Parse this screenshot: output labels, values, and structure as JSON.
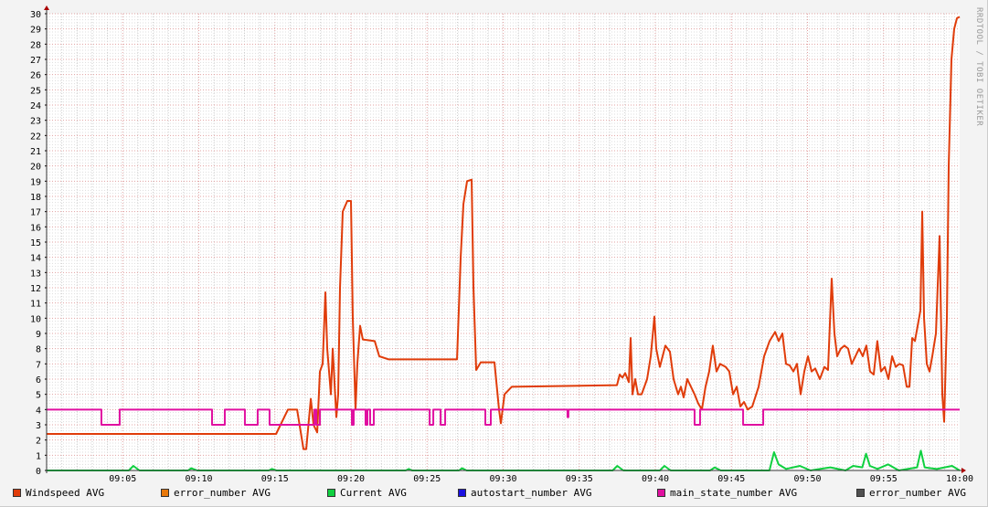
{
  "chart_data": {
    "type": "line",
    "title": "",
    "xlabel": "",
    "ylabel": "",
    "xlim_minutes": [
      0,
      60
    ],
    "ylim": [
      0,
      30
    ],
    "grid": true,
    "legend_placement": "bottom",
    "x_ticks": [
      {
        "m": 5,
        "label": "09:05"
      },
      {
        "m": 10,
        "label": "09:10"
      },
      {
        "m": 15,
        "label": "09:15"
      },
      {
        "m": 20,
        "label": "09:20"
      },
      {
        "m": 25,
        "label": "09:25"
      },
      {
        "m": 30,
        "label": "09:30"
      },
      {
        "m": 35,
        "label": "09:35"
      },
      {
        "m": 40,
        "label": "09:40"
      },
      {
        "m": 45,
        "label": "09:45"
      },
      {
        "m": 50,
        "label": "09:50"
      },
      {
        "m": 55,
        "label": "09:55"
      },
      {
        "m": 60,
        "label": "10:00"
      }
    ],
    "y_ticks": [
      0,
      1,
      2,
      3,
      4,
      5,
      6,
      7,
      8,
      9,
      10,
      11,
      12,
      13,
      14,
      15,
      16,
      17,
      18,
      19,
      20,
      21,
      22,
      23,
      24,
      25,
      26,
      27,
      28,
      29,
      30
    ],
    "watermark": "RRDTOOL / TOBI OETIKER",
    "series": [
      {
        "name": "Windspeed AVG",
        "color": "#e03c0a",
        "step": false,
        "points": [
          [
            0,
            2.4
          ],
          [
            15.08,
            2.4
          ],
          [
            15.86,
            4
          ],
          [
            16.46,
            4
          ],
          [
            16.88,
            1.4
          ],
          [
            17.06,
            1.4
          ],
          [
            17.36,
            4.7
          ],
          [
            17.54,
            3
          ],
          [
            17.78,
            2.5
          ],
          [
            17.96,
            6.5
          ],
          [
            18.14,
            7
          ],
          [
            18.32,
            11.7
          ],
          [
            18.44,
            8
          ],
          [
            18.68,
            5
          ],
          [
            18.8,
            8
          ],
          [
            19.04,
            3.5
          ],
          [
            19.16,
            5
          ],
          [
            19.28,
            12
          ],
          [
            19.46,
            17
          ],
          [
            19.76,
            17.7
          ],
          [
            20.0,
            17.7
          ],
          [
            20.12,
            10
          ],
          [
            20.3,
            4
          ],
          [
            20.42,
            7
          ],
          [
            20.6,
            9.5
          ],
          [
            20.78,
            8.6
          ],
          [
            21.56,
            8.5
          ],
          [
            21.86,
            7.5
          ],
          [
            22.46,
            7.3
          ],
          [
            26.97,
            7.3
          ],
          [
            27.21,
            14
          ],
          [
            27.39,
            17.5
          ],
          [
            27.63,
            19
          ],
          [
            27.93,
            19.1
          ],
          [
            28.05,
            12
          ],
          [
            28.23,
            6.6
          ],
          [
            28.53,
            7.1
          ],
          [
            29.43,
            7.1
          ],
          [
            29.73,
            4
          ],
          [
            29.85,
            3.1
          ],
          [
            30.09,
            5
          ],
          [
            30.57,
            5.5
          ],
          [
            37.48,
            5.6
          ],
          [
            37.66,
            6.3
          ],
          [
            37.84,
            6.1
          ],
          [
            38.02,
            6.4
          ],
          [
            38.26,
            5.8
          ],
          [
            38.38,
            8.7
          ],
          [
            38.5,
            5
          ],
          [
            38.68,
            6
          ],
          [
            38.86,
            5
          ],
          [
            39.1,
            5
          ],
          [
            39.46,
            6
          ],
          [
            39.7,
            7.5
          ],
          [
            39.94,
            10.1
          ],
          [
            40.06,
            8
          ],
          [
            40.3,
            6.8
          ],
          [
            40.66,
            8.2
          ],
          [
            40.96,
            7.8
          ],
          [
            41.2,
            6
          ],
          [
            41.5,
            5
          ],
          [
            41.68,
            5.5
          ],
          [
            41.86,
            4.8
          ],
          [
            42.1,
            6
          ],
          [
            42.34,
            5.5
          ],
          [
            42.58,
            5
          ],
          [
            42.82,
            4.4
          ],
          [
            43.06,
            4
          ],
          [
            43.3,
            5.5
          ],
          [
            43.54,
            6.5
          ],
          [
            43.78,
            8.2
          ],
          [
            44.02,
            6.5
          ],
          [
            44.26,
            7
          ],
          [
            44.62,
            6.8
          ],
          [
            44.86,
            6.5
          ],
          [
            45.11,
            5
          ],
          [
            45.35,
            5.5
          ],
          [
            45.59,
            4.2
          ],
          [
            45.83,
            4.5
          ],
          [
            46.07,
            4
          ],
          [
            46.37,
            4.2
          ],
          [
            46.79,
            5.5
          ],
          [
            47.15,
            7.5
          ],
          [
            47.51,
            8.5
          ],
          [
            47.87,
            9.1
          ],
          [
            48.11,
            8.5
          ],
          [
            48.35,
            9
          ],
          [
            48.59,
            7
          ],
          [
            48.83,
            6.9
          ],
          [
            49.07,
            6.5
          ],
          [
            49.31,
            7
          ],
          [
            49.55,
            5
          ],
          [
            49.79,
            6.5
          ],
          [
            50.03,
            7.5
          ],
          [
            50.27,
            6.5
          ],
          [
            50.51,
            6.7
          ],
          [
            50.81,
            6
          ],
          [
            51.11,
            6.8
          ],
          [
            51.35,
            6.6
          ],
          [
            51.59,
            12.6
          ],
          [
            51.77,
            9
          ],
          [
            51.95,
            7.5
          ],
          [
            52.19,
            8
          ],
          [
            52.43,
            8.2
          ],
          [
            52.67,
            8
          ],
          [
            52.91,
            7
          ],
          [
            53.15,
            7.5
          ],
          [
            53.39,
            8
          ],
          [
            53.63,
            7.5
          ],
          [
            53.87,
            8.2
          ],
          [
            54.11,
            6.5
          ],
          [
            54.35,
            6.3
          ],
          [
            54.59,
            8.5
          ],
          [
            54.83,
            6.5
          ],
          [
            55.08,
            6.8
          ],
          [
            55.32,
            6
          ],
          [
            55.56,
            7.5
          ],
          [
            55.8,
            6.8
          ],
          [
            56.04,
            7
          ],
          [
            56.28,
            6.9
          ],
          [
            56.52,
            5.5
          ],
          [
            56.7,
            5.5
          ],
          [
            56.88,
            8.7
          ],
          [
            57.06,
            8.5
          ],
          [
            57.24,
            9.5
          ],
          [
            57.42,
            10.5
          ],
          [
            57.54,
            17
          ],
          [
            57.66,
            10
          ],
          [
            57.84,
            7
          ],
          [
            58.02,
            6.5
          ],
          [
            58.2,
            7.5
          ],
          [
            58.44,
            9
          ],
          [
            58.68,
            15.4
          ],
          [
            58.86,
            5
          ],
          [
            58.98,
            3.2
          ],
          [
            59.16,
            10
          ],
          [
            59.28,
            20
          ],
          [
            59.46,
            27
          ],
          [
            59.64,
            29
          ],
          [
            59.82,
            29.7
          ],
          [
            60,
            29.8
          ]
        ]
      },
      {
        "name": "error_number AVG",
        "color": "#e8780a",
        "step": false,
        "points": []
      },
      {
        "name": "Current AVG",
        "color": "#10d040",
        "step": false,
        "points": [
          [
            0,
            0
          ],
          [
            5.4,
            0
          ],
          [
            5.7,
            0.3
          ],
          [
            6.1,
            0
          ],
          [
            9.3,
            0
          ],
          [
            9.5,
            0.15
          ],
          [
            9.9,
            0
          ],
          [
            14.6,
            0
          ],
          [
            14.8,
            0.1
          ],
          [
            15.1,
            0
          ],
          [
            23.6,
            0
          ],
          [
            23.8,
            0.1
          ],
          [
            24.0,
            0
          ],
          [
            27.1,
            0
          ],
          [
            27.3,
            0.15
          ],
          [
            27.6,
            0
          ],
          [
            37.2,
            0
          ],
          [
            37.5,
            0.3
          ],
          [
            37.9,
            0
          ],
          [
            40.3,
            0
          ],
          [
            40.6,
            0.3
          ],
          [
            41.0,
            0
          ],
          [
            43.6,
            0
          ],
          [
            43.9,
            0.2
          ],
          [
            44.3,
            0
          ],
          [
            47.5,
            0
          ],
          [
            47.8,
            1.2
          ],
          [
            48.1,
            0.4
          ],
          [
            48.6,
            0.1
          ],
          [
            49.5,
            0.3
          ],
          [
            50.2,
            0
          ],
          [
            51.5,
            0.2
          ],
          [
            52.5,
            0
          ],
          [
            53.0,
            0.3
          ],
          [
            53.6,
            0.2
          ],
          [
            53.85,
            1.1
          ],
          [
            54.1,
            0.3
          ],
          [
            54.6,
            0.1
          ],
          [
            55.3,
            0.4
          ],
          [
            56.0,
            0
          ],
          [
            57.2,
            0.2
          ],
          [
            57.45,
            1.3
          ],
          [
            57.7,
            0.2
          ],
          [
            58.5,
            0.1
          ],
          [
            59.5,
            0.3
          ],
          [
            60,
            0
          ]
        ]
      },
      {
        "name": "autostart_number AVG",
        "color": "#1a10e0",
        "step": false,
        "points": []
      },
      {
        "name": "main_state_number AVG",
        "color": "#e010a0",
        "step": true,
        "points": [
          [
            0,
            4
          ],
          [
            3.6,
            3
          ],
          [
            4.8,
            4
          ],
          [
            10.87,
            3
          ],
          [
            11.71,
            4
          ],
          [
            13.03,
            3
          ],
          [
            13.87,
            4
          ],
          [
            14.65,
            3
          ],
          [
            17.6,
            4
          ],
          [
            17.72,
            3
          ],
          [
            17.96,
            4
          ],
          [
            20.06,
            3
          ],
          [
            20.18,
            4
          ],
          [
            20.96,
            3
          ],
          [
            21.08,
            4
          ],
          [
            21.26,
            3
          ],
          [
            21.5,
            4
          ],
          [
            25.17,
            3
          ],
          [
            25.41,
            4
          ],
          [
            25.89,
            3
          ],
          [
            26.19,
            4
          ],
          [
            28.83,
            3
          ],
          [
            29.19,
            4
          ],
          [
            34.23,
            3.5
          ],
          [
            34.29,
            4
          ],
          [
            42.58,
            3
          ],
          [
            42.94,
            4
          ],
          [
            45.77,
            3
          ],
          [
            47.09,
            4
          ],
          [
            60,
            4
          ]
        ]
      },
      {
        "name": "error_number AVG",
        "color": "#505050",
        "step": false,
        "points": []
      }
    ]
  }
}
